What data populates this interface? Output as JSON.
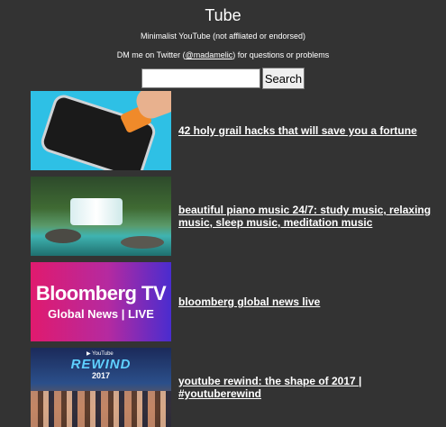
{
  "header": {
    "title": "Tube",
    "subtitle": "Minimalist YouTube (not affliated or endorsed)",
    "dm_prefix": "DM me on Twitter (",
    "dm_handle": "@madamelic",
    "dm_suffix": ") for questions or problems"
  },
  "search": {
    "value": "",
    "placeholder": "",
    "button_label": "Search"
  },
  "results": [
    {
      "title": "42 holy grail hacks that will save you a fortune",
      "thumbnail": "phone-screen-hack"
    },
    {
      "title": "beautiful piano music 24/7: study music, relaxing music, sleep music, meditation music",
      "thumbnail": "waterfall"
    },
    {
      "title": "bloomberg global news live",
      "thumbnail": "bloomberg-tv",
      "thumb_text_main": "Bloomberg TV",
      "thumb_text_sub": "Global News | LIVE"
    },
    {
      "title": "youtube rewind: the shape of 2017 | #youtuberewind",
      "thumbnail": "youtube-rewind",
      "thumb_text_brand": "▶ YouTube",
      "thumb_text_main": "REWIND",
      "thumb_text_sub": "2017"
    }
  ],
  "colors": {
    "background": "#333333",
    "text": "#ffffff"
  }
}
